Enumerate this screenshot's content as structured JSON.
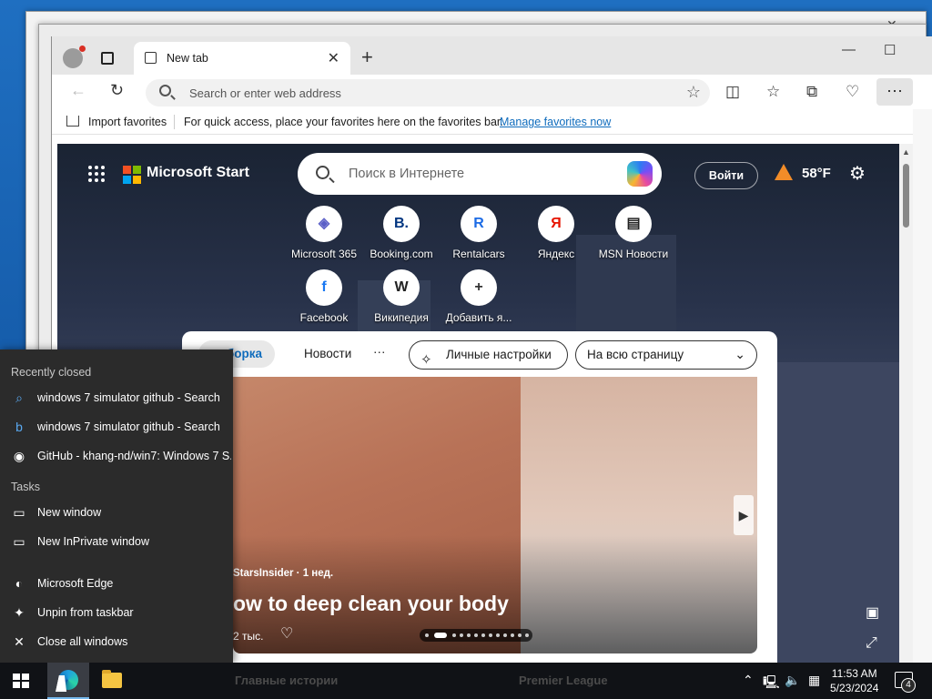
{
  "browser": {
    "tab_title": "New tab",
    "address_placeholder": "Search or enter web address",
    "favbar": {
      "import_label": "Import favorites",
      "hint": "For quick access, place your favorites here on the favorites bar.",
      "manage_link": "Manage favorites now"
    }
  },
  "page": {
    "brand": "Microsoft Start",
    "search_placeholder": "Поиск в Интернете",
    "login_label": "Войти",
    "weather_temp": "58°F",
    "quick_links": [
      {
        "label": "Microsoft 365",
        "glyph": "◈",
        "icon": "microsoft365-icon",
        "color": "#5b5fc7"
      },
      {
        "label": "Booking.com",
        "glyph": "B.",
        "icon": "booking-icon",
        "color": "#003580"
      },
      {
        "label": "Rentalcars",
        "glyph": "R",
        "icon": "rentalcars-icon",
        "color": "#1c6be5"
      },
      {
        "label": "Яндекс",
        "glyph": "Я",
        "icon": "yandex-icon",
        "color": "#e61400"
      },
      {
        "label": "MSN Новости",
        "glyph": "▤",
        "icon": "msn-news-icon",
        "color": "#222222"
      },
      {
        "label": "Facebook",
        "glyph": "f",
        "icon": "facebook-icon",
        "color": "#1877f2"
      },
      {
        "label": "Википедия",
        "glyph": "W",
        "icon": "wikipedia-icon",
        "color": "#222222"
      },
      {
        "label": "Добавить я...",
        "glyph": "+",
        "icon": "add-icon",
        "color": "#333333"
      }
    ],
    "feed_tabs": {
      "active": "ыборка",
      "news": "Новости",
      "more": "···",
      "personalize": "Личные настройки",
      "layout_select": "На всю страницу"
    },
    "hero": {
      "source": "StarsInsider · 1 нед.",
      "headline": "ow to deep clean your body",
      "likes": "2 тыс."
    }
  },
  "jumplist": {
    "recent_heading": "Recently closed",
    "recent": [
      {
        "label": "windows 7 simulator github - Search",
        "icon": "search-icon"
      },
      {
        "label": "windows 7 simulator github - Search",
        "icon": "bing-icon"
      },
      {
        "label": "GitHub - khang-nd/win7: Windows 7 S...",
        "icon": "github-icon"
      }
    ],
    "tasks_heading": "Tasks",
    "tasks": [
      {
        "label": "New window",
        "icon": "new-window-icon"
      },
      {
        "label": "New InPrivate window",
        "icon": "inprivate-window-icon"
      }
    ],
    "app_items": [
      {
        "label": "Microsoft Edge",
        "icon": "edge-icon"
      },
      {
        "label": "Unpin from taskbar",
        "icon": "unpin-icon"
      },
      {
        "label": "Close all windows",
        "icon": "close-icon"
      }
    ]
  },
  "taskbar": {
    "ghost_news": "Главные истории",
    "ghost_league": "Premier League",
    "time": "11:53 AM",
    "date": "5/23/2024",
    "notification_count": "4"
  },
  "colors": {
    "accent": "#0f6cbd",
    "ms_red": "#f25022",
    "ms_green": "#7fba00",
    "ms_blue": "#00a4ef",
    "ms_yellow": "#ffb900"
  }
}
